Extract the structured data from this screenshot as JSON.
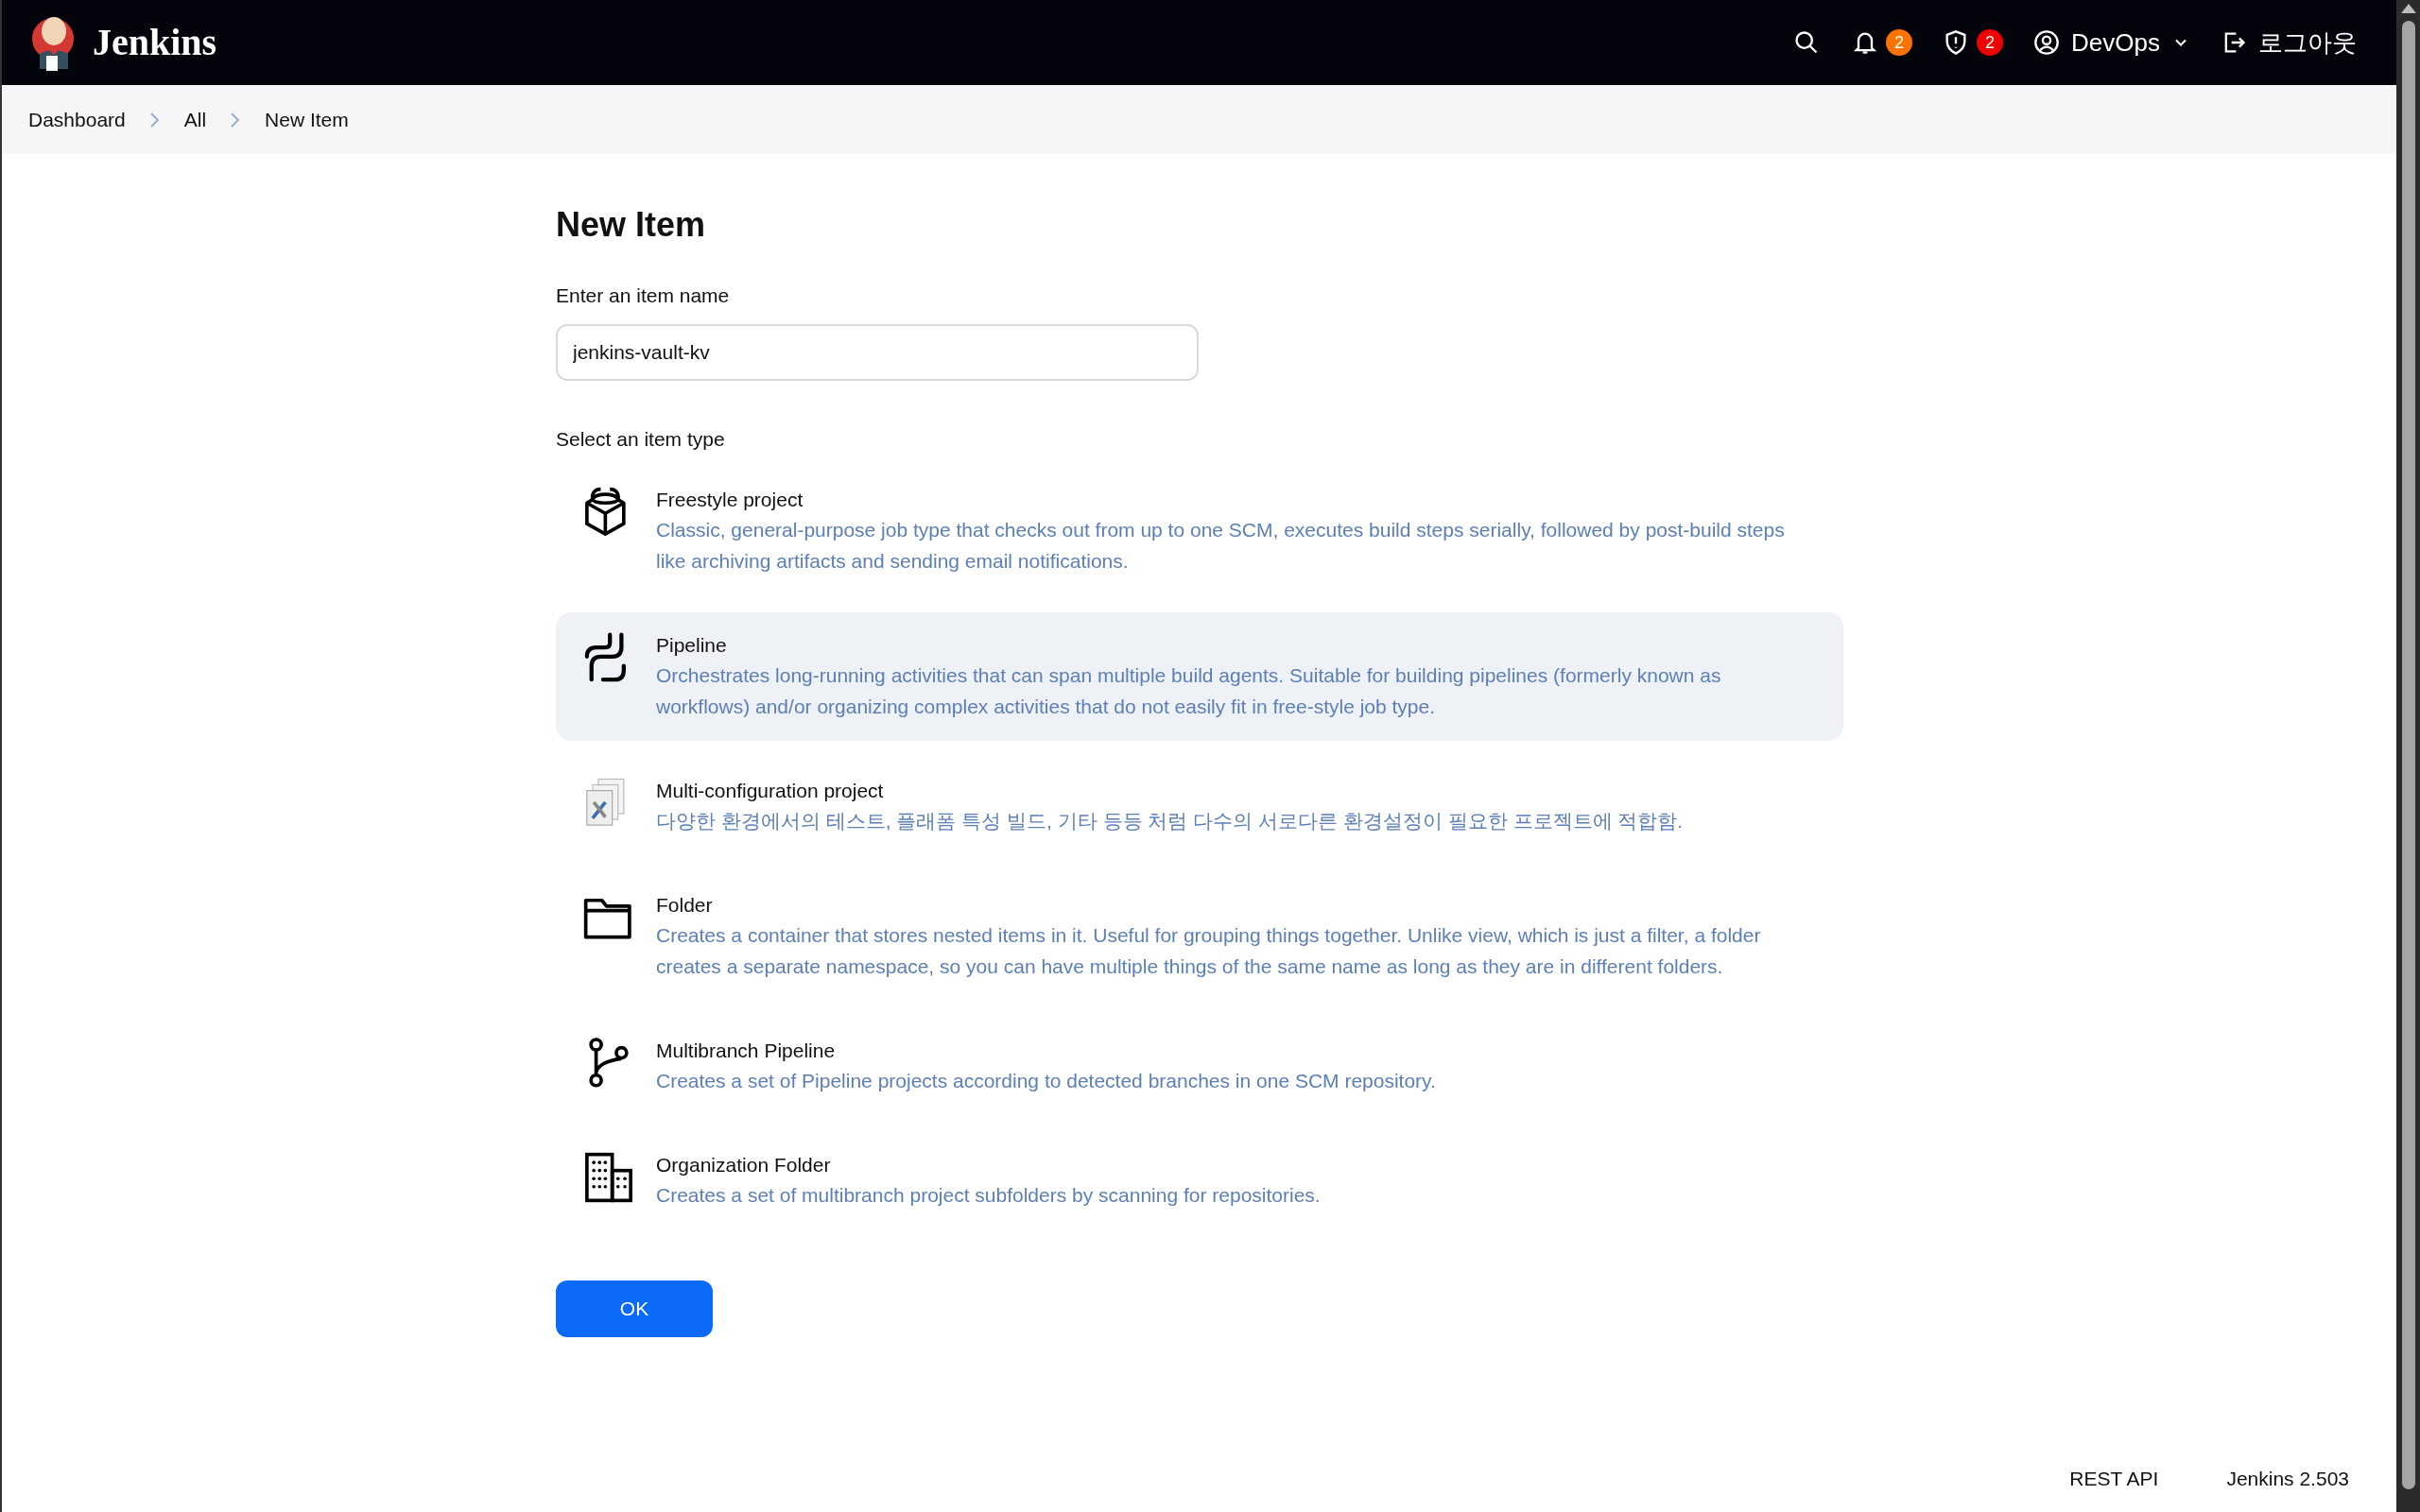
{
  "header": {
    "logo_text": "Jenkins",
    "notifications": {
      "count": "2",
      "color": "#fe7200"
    },
    "security": {
      "count": "2",
      "color": "#f00000"
    },
    "user": "DevOps",
    "logout": "로그아웃"
  },
  "breadcrumbs": [
    "Dashboard",
    "All",
    "New Item"
  ],
  "page_title": "New Item",
  "name_field": {
    "label": "Enter an item name",
    "value": "jenkins-vault-kv"
  },
  "type_label": "Select an item type",
  "item_types": [
    {
      "title": "Freestyle project",
      "description": "Classic, general-purpose job type that checks out from up to one SCM, executes build steps serially, followed by post-build steps like archiving artifacts and sending email notifications.",
      "selected": false
    },
    {
      "title": "Pipeline",
      "description": "Orchestrates long-running activities that can span multiple build agents. Suitable for building pipelines (formerly known as workflows) and/or organizing complex activities that do not easily fit in free-style job type.",
      "selected": true
    },
    {
      "title": "Multi-configuration project",
      "description": "다양한 환경에서의 테스트, 플래폼 특성 빌드, 기타 등등 처럼 다수의 서로다른 환경설정이 필요한 프로젝트에 적합함.",
      "selected": false
    },
    {
      "title": "Folder",
      "description": "Creates a container that stores nested items in it. Useful for grouping things together. Unlike view, which is just a filter, a folder creates a separate namespace, so you can have multiple things of the same name as long as they are in different folders.",
      "selected": false
    },
    {
      "title": "Multibranch Pipeline",
      "description": "Creates a set of Pipeline projects according to detected branches in one SCM repository.",
      "selected": false
    },
    {
      "title": "Organization Folder",
      "description": "Creates a set of multibranch project subfolders by scanning for repositories.",
      "selected": false
    }
  ],
  "ok_button": "OK",
  "footer": [
    "REST API",
    "Jenkins 2.503"
  ]
}
